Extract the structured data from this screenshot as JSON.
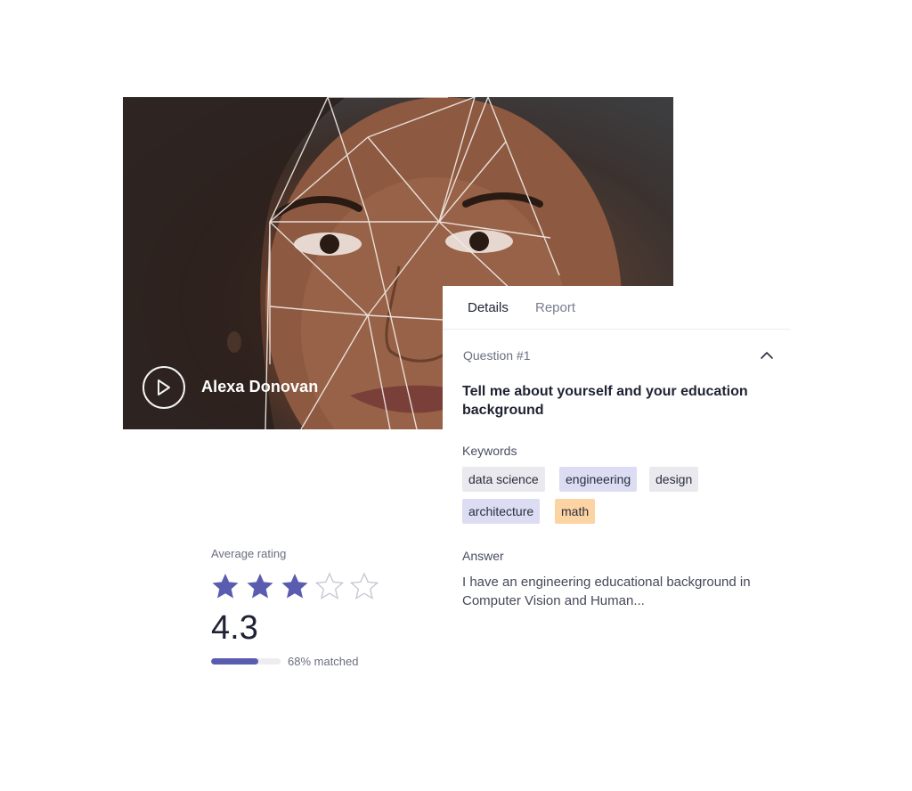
{
  "video": {
    "person_name": "Alexa Donovan",
    "play_icon": "play-circle-icon"
  },
  "panel": {
    "tabs": [
      {
        "label": "Details",
        "active": true
      },
      {
        "label": "Report",
        "active": false
      }
    ],
    "question_label": "Question #1",
    "collapse_icon": "chevron-up-icon",
    "question_text": "Tell me about yourself and your education background",
    "keywords_label": "Keywords",
    "keywords": [
      {
        "label": "data science",
        "color": "#e9e9ee"
      },
      {
        "label": "engineering",
        "color": "#dcdcf3"
      },
      {
        "label": "design",
        "color": "#e9e9ee"
      },
      {
        "label": "architecture",
        "color": "#dcdcf3"
      },
      {
        "label": "math",
        "color": "#fcd3a2"
      }
    ],
    "answer_label": "Answer",
    "answer_text": "I have an engineering educational background in Computer Vision and Human..."
  },
  "rating": {
    "label": "Average rating",
    "stars_filled": 3,
    "stars_total": 5,
    "value": "4.3",
    "match_fraction": 0.68,
    "match_text": "68% matched",
    "accent_color": "#5a5cb0"
  }
}
